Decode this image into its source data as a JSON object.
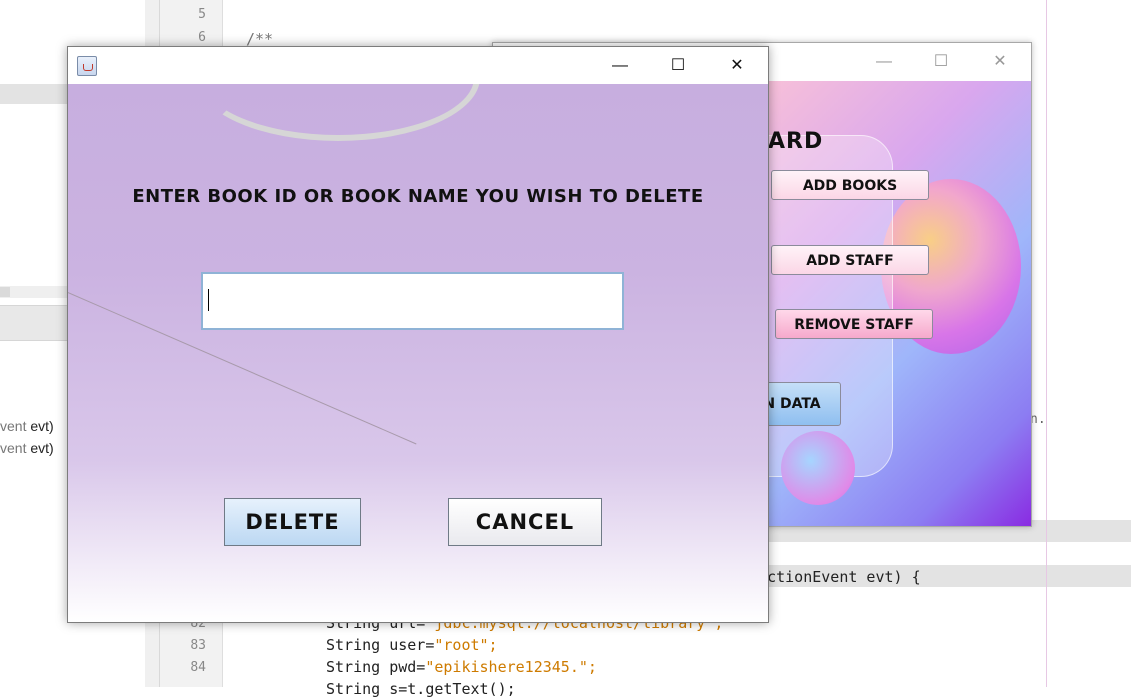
{
  "ide": {
    "line_numbers_top": [
      "5",
      "6"
    ],
    "code_top": [
      "/**"
    ],
    "left_method_lines": [
      {
        "muted": "vent",
        "text": " evt)"
      },
      {
        "muted": "vent",
        "text": " evt)"
      }
    ],
    "line_numbers_bottom": [
      "82",
      "83",
      "84"
    ],
    "code_action_fragment": "t.ActionEvent evt) {",
    "code_url_prefix": "String url=",
    "code_url_value": "\"jdbc:mysql://localhost/library\";",
    "code_user_prefix": "String user=",
    "code_user_value": "\"root\";",
    "code_pwd_prefix": "String pwd=",
    "code_pwd_value": "\"epikishere12345.\";",
    "code_partial": "String s=t.getText();",
    "right_fragment": "n."
  },
  "dashboard": {
    "heading_partial": "ARD",
    "buttons": {
      "add_books": "ADD BOOKS",
      "add_staff": "ADD STAFF",
      "remove_staff": "REMOVE STAFF",
      "data_partial": "N DATA"
    },
    "controls": {
      "minimize": "—",
      "maximize": "☐",
      "close": "✕"
    }
  },
  "dialog": {
    "controls": {
      "minimize": "—",
      "maximize": "☐",
      "close": "✕"
    },
    "prompt": "ENTER BOOK ID OR BOOK NAME YOU WISH TO DELETE",
    "input_value": "",
    "delete_label": "DELETE",
    "cancel_label": "CANCEL"
  }
}
